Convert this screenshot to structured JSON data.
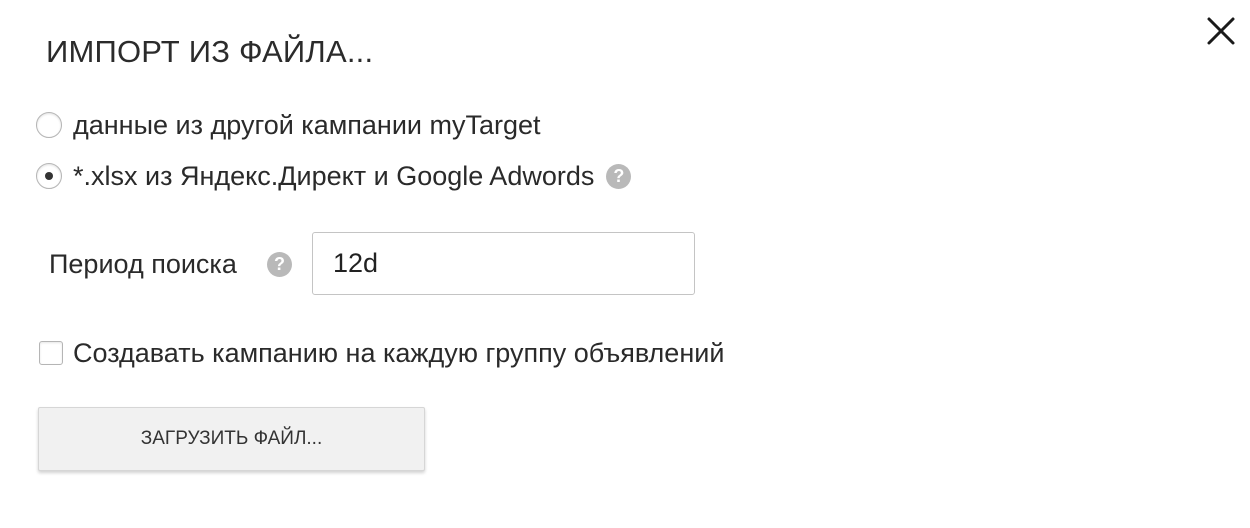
{
  "dialog": {
    "title": "ИМПОРТ ИЗ ФАЙЛА..."
  },
  "source_options": [
    {
      "label": "данные из другой кампании myTarget",
      "selected": false,
      "has_help": false
    },
    {
      "label": "*.xlsx из Яндекс.Директ и Google Adwords",
      "selected": true,
      "has_help": true
    }
  ],
  "period": {
    "label": "Период поиска",
    "value": "12d"
  },
  "create_campaign_checkbox": {
    "label": "Создавать кампанию на каждую группу объявлений",
    "checked": false
  },
  "upload_button": {
    "label": "ЗАГРУЗИТЬ ФАЙЛ..."
  },
  "help_glyph": "?",
  "icons": {
    "close": "close-icon",
    "help": "question-circle-icon"
  }
}
